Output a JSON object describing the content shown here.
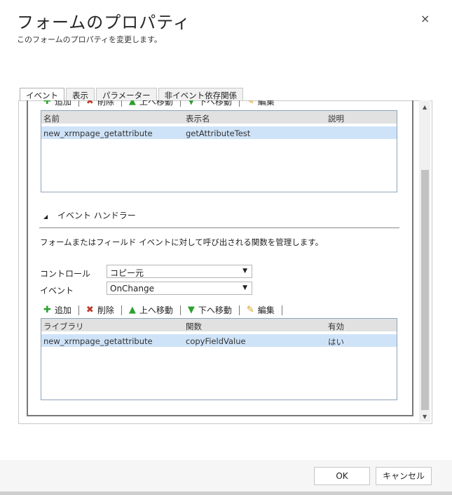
{
  "dialog": {
    "title": "フォームのプロパティ",
    "subtitle": "このフォームのプロパティを変更します。",
    "close_glyph": "×"
  },
  "tabs": [
    {
      "label": "イベント",
      "active": true
    },
    {
      "label": "表示",
      "active": false
    },
    {
      "label": "パラメーター",
      "active": false
    },
    {
      "label": "非イベント依存関係",
      "active": false
    }
  ],
  "library_toolbar": [
    "追加",
    "削除",
    "上へ移動",
    "下へ移動",
    "編集"
  ],
  "library_grid": {
    "headers": [
      "名前",
      "表示名",
      "説明"
    ],
    "rows": [
      [
        "new_xrmpage_getattribute",
        "getAttributeTest",
        ""
      ]
    ]
  },
  "handlers": {
    "section_title": "イベント ハンドラー",
    "description": "フォームまたはフィールド イベントに対して呼び出される関数を管理します。",
    "control_label": "コントロール",
    "control_value": "コピー元",
    "event_label": "イベント",
    "event_value": "OnChange",
    "toolbar": {
      "add": "追加",
      "delete": "削除",
      "up": "上へ移動",
      "down": "下へ移動",
      "edit": "編集"
    },
    "grid": {
      "headers": [
        "ライブラリ",
        "関数",
        "有効"
      ],
      "rows": [
        [
          "new_xrmpage_getattribute",
          "copyFieldValue",
          "はい"
        ]
      ]
    }
  },
  "footer": {
    "ok_label": "OK",
    "cancel_label": "キャンセル"
  },
  "colors": {
    "selected_row": "#cfe3f8",
    "grid_header": "#e1e1e1",
    "add_green": "#2ea02e",
    "delete_red": "#c0392b"
  }
}
